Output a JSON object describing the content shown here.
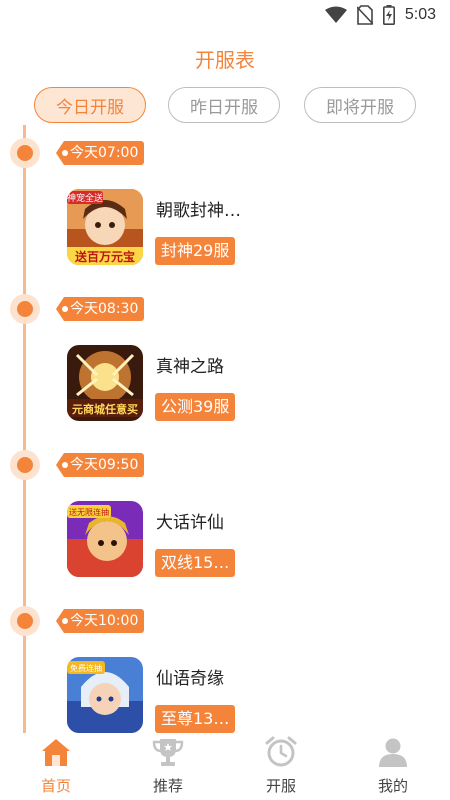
{
  "status_bar": {
    "time": "5:03",
    "icons": [
      "wifi-icon",
      "no-sim-icon",
      "battery-charging-icon"
    ]
  },
  "header": {
    "title": "开服表"
  },
  "tabs": [
    {
      "label": "今日开服",
      "active": true
    },
    {
      "label": "昨日开服",
      "active": false
    },
    {
      "label": "即将开服",
      "active": false
    }
  ],
  "timeline": [
    {
      "time": "今天07:00",
      "game": {
        "name": "朝歌封神…",
        "badge": "封神29服",
        "icon_banner": "送百万元宝",
        "icon_tag": "神宠全送"
      }
    },
    {
      "time": "今天08:30",
      "game": {
        "name": "真神之路",
        "badge": "公测39服",
        "icon_banner": "元商城任意买"
      }
    },
    {
      "time": "今天09:50",
      "game": {
        "name": "大话许仙",
        "badge": "双线15…",
        "icon_tag": "送无限连抽"
      }
    },
    {
      "time": "今天10:00",
      "game": {
        "name": "仙语奇缘",
        "badge": "至尊13…",
        "icon_tag": "免费连抽"
      }
    }
  ],
  "bottom_nav": [
    {
      "label": "首页",
      "icon": "home-icon",
      "active": true
    },
    {
      "label": "推荐",
      "icon": "trophy-icon",
      "active": false
    },
    {
      "label": "开服",
      "icon": "alarm-clock-icon",
      "active": false
    },
    {
      "label": "我的",
      "icon": "user-icon",
      "active": false
    }
  ],
  "colors": {
    "accent": "#f5843b",
    "accent_light": "#fde7d4",
    "inactive": "#bdbdbd",
    "icon_gray": "#c4c4c4"
  }
}
